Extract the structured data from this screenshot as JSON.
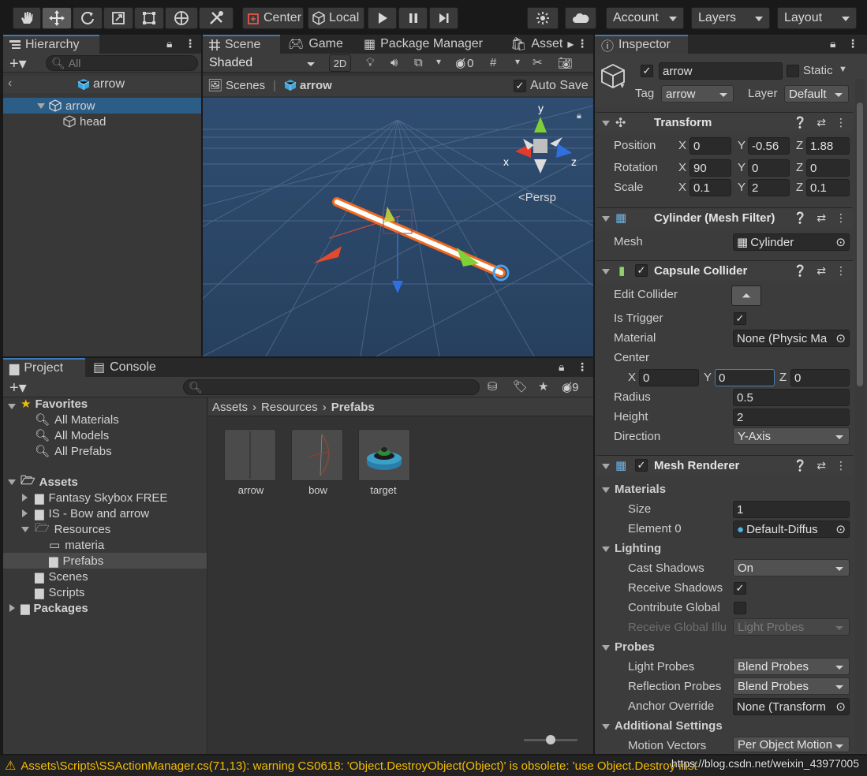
{
  "toolbar": {
    "tools": [
      "hand-tool",
      "move-tool",
      "rotate-tool",
      "scale-tool",
      "rect-tool",
      "transform-tool",
      "custom-tool"
    ],
    "pivot_label": "Center",
    "space_label": "Local",
    "account_label": "Account",
    "layers_label": "Layers",
    "layout_label": "Layout"
  },
  "hierarchy": {
    "tab_label": "Hierarchy",
    "search_placeholder": "All",
    "breadcrumb": "arrow",
    "items": [
      {
        "label": "arrow"
      },
      {
        "label": "head"
      }
    ]
  },
  "scene": {
    "tabs": [
      "Scene",
      "Game",
      "Package Manager",
      "Asset"
    ],
    "shading": "Shaded",
    "mode_2d": "2D",
    "hidden_count": "0",
    "breadcrumb_root": "Scenes",
    "breadcrumb_item": "arrow",
    "auto_save_label": "Auto Save",
    "persp_label": "Persp",
    "gizmo": {
      "x": "x",
      "y": "y",
      "z": "z"
    }
  },
  "project": {
    "tabs": [
      "Project",
      "Console"
    ],
    "hidden_count": "9",
    "breadcrumb": [
      "Assets",
      "Resources",
      "Prefabs"
    ],
    "favorites_label": "Favorites",
    "favorites": [
      "All Materials",
      "All Models",
      "All Prefabs"
    ],
    "assets_label": "Assets",
    "assets_folders": [
      "Fantasy Skybox FREE",
      "IS - Bow and arrow",
      "Resources"
    ],
    "resources_children": [
      "materia",
      "Prefabs"
    ],
    "assets_more": [
      "Scenes",
      "Scripts"
    ],
    "packages_label": "Packages",
    "prefabs": [
      {
        "label": "arrow"
      },
      {
        "label": "bow"
      },
      {
        "label": "target"
      }
    ]
  },
  "inspector": {
    "tab_label": "Inspector",
    "object_name": "arrow",
    "static_label": "Static",
    "tag_label": "Tag",
    "tag_value": "arrow",
    "layer_label": "Layer",
    "layer_value": "Default",
    "transform": {
      "title": "Transform",
      "position": {
        "label": "Position",
        "x": "0",
        "y": "-0.56",
        "z": "1.88"
      },
      "rotation": {
        "label": "Rotation",
        "x": "90",
        "y": "0",
        "z": "0"
      },
      "scale": {
        "label": "Scale",
        "x": "0.1",
        "y": "2",
        "z": "0.1"
      }
    },
    "mesh_filter": {
      "title": "Cylinder (Mesh Filter)",
      "mesh_label": "Mesh",
      "mesh_value": "Cylinder"
    },
    "capsule": {
      "title": "Capsule Collider",
      "edit_label": "Edit Collider",
      "trigger_label": "Is Trigger",
      "material_label": "Material",
      "material_value": "None (Physic Ma",
      "center_label": "Center",
      "center": {
        "x": "0",
        "y": "0",
        "z": "0"
      },
      "radius_label": "Radius",
      "radius": "0.5",
      "height_label": "Height",
      "height": "2",
      "direction_label": "Direction",
      "direction": "Y-Axis"
    },
    "mesh_renderer": {
      "title": "Mesh Renderer",
      "materials_label": "Materials",
      "size_label": "Size",
      "size": "1",
      "element_label": "Element 0",
      "element": "Default-Diffus",
      "lighting_label": "Lighting",
      "cast_label": "Cast Shadows",
      "cast": "On",
      "receive_label": "Receive Shadows",
      "contribute_label": "Contribute Global",
      "receive_gi_label": "Receive Global Illu",
      "receive_gi": "Light Probes",
      "probes_label": "Probes",
      "light_probes_label": "Light Probes",
      "light_probes": "Blend Probes",
      "reflection_label": "Reflection Probes",
      "reflection": "Blend Probes",
      "anchor_label": "Anchor Override",
      "anchor": "None (Transform",
      "additional_label": "Additional Settings",
      "motion_label": "Motion Vectors",
      "motion": "Per Object Motion"
    }
  },
  "status": {
    "message": "Assets\\Scripts\\SSActionManager.cs(71,13): warning CS0618: 'Object.DestroyObject(Object)' is obsolete: 'use Object.Destroy inst",
    "watermark": "https://blog.csdn.net/weixin_43977005"
  },
  "colors": {
    "accent": "#3a79bb",
    "selection": "#2c5d87",
    "warning": "#f4bc02"
  }
}
